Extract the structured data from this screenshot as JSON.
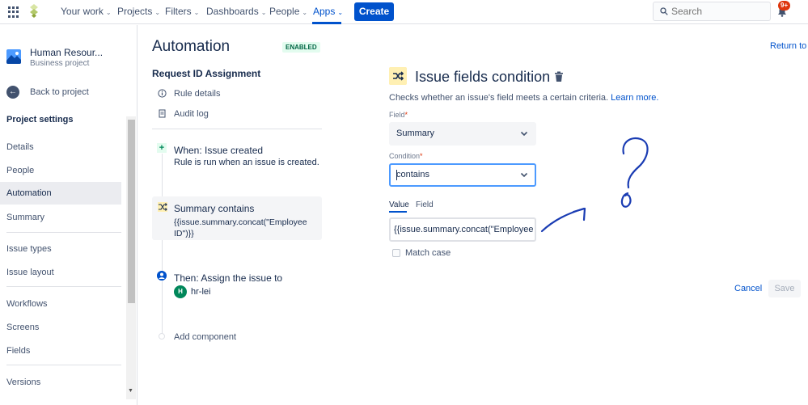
{
  "topnav": {
    "items": [
      "Your work",
      "Projects",
      "Filters",
      "Dashboards",
      "People",
      "Apps"
    ],
    "create_label": "Create",
    "search_placeholder": "Search",
    "notifications_badge": "9+"
  },
  "sidebar": {
    "project_name": "Human Resour...",
    "project_type": "Business project",
    "back_label": "Back to project",
    "section_title": "Project settings",
    "items": [
      "Details",
      "People",
      "Automation",
      "Summary",
      "Issue types",
      "Issue layout",
      "Workflows",
      "Screens",
      "Fields",
      "Versions"
    ],
    "selected_item": "Automation"
  },
  "automation": {
    "title": "Automation",
    "status": "ENABLED",
    "rule_name": "Request ID Assignment",
    "rule_details_label": "Rule details",
    "audit_log_label": "Audit log",
    "trigger": {
      "title": "When: Issue created",
      "subtitle": "Rule is run when an issue is created."
    },
    "condition": {
      "title": "Summary contains",
      "subtitle": "{{issue.summary.concat(\"Employee ID\")}}"
    },
    "action": {
      "title": "Then: Assign the issue to",
      "user_initial": "H",
      "user_name": "hr-lei"
    },
    "add_component_label": "Add component"
  },
  "panel": {
    "return_label": "Return to l",
    "title": "Issue fields condition",
    "description": "Checks whether an issue's field meets a certain criteria.",
    "learn_more": "Learn more.",
    "field_label": "Field",
    "field_value": "Summary",
    "condition_label": "Condition",
    "condition_value": "contains",
    "tab_value": "Value",
    "tab_field": "Field",
    "value_input": "{{issue.summary.concat(\"Employee ID\")}}",
    "match_case_label": "Match case",
    "cancel_label": "Cancel",
    "save_label": "Save",
    "required_mark": "*"
  },
  "colors": {
    "brand": "#0052cc",
    "enabled_bg": "#e3fcef",
    "enabled_text": "#006644",
    "condition_bg": "#fff0b3",
    "badge": "#de350b",
    "annotation_ink": "#1a3cb3"
  },
  "icons": [
    "apps-grid-icon",
    "jira-logo-icon",
    "search-icon",
    "bell-icon",
    "project-avatar-icon",
    "back-arrow-icon",
    "info-icon",
    "audit-log-icon",
    "plus-icon",
    "shuffle-icon",
    "user-circle-icon",
    "trash-icon",
    "chevron-down-icon"
  ]
}
